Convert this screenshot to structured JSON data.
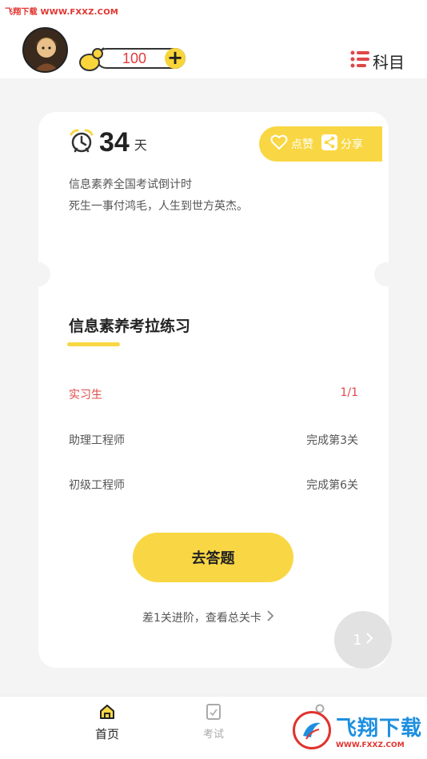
{
  "watermark": {
    "top_text": "飞翔下载 WWW.FXXZ.COM",
    "logo_name": "飞翔下载",
    "logo_url": "WWW.FXXZ.COM"
  },
  "header": {
    "avatar_icon": "avatar-image",
    "coins": "100",
    "coin_icon": "gourd-icon",
    "plus_icon": "plus-icon",
    "subject_label": "科目",
    "subject_icon": "list-icon"
  },
  "card": {
    "countdown_number": "34",
    "countdown_unit": "天",
    "countdown_icon": "alarm-clock-icon",
    "like_label": "点赞",
    "share_label": "分享",
    "subtitle": "信息素养全国考试倒计时",
    "motto": "死生一事付鸿毛，人生到世方英杰。",
    "section_title": "信息素养考拉练习",
    "levels": [
      {
        "name": "实习生",
        "status": "1/1",
        "active": true
      },
      {
        "name": "助理工程师",
        "status": "完成第3关",
        "active": false
      },
      {
        "name": "初级工程师",
        "status": "完成第6关",
        "active": false
      }
    ],
    "go_button": "去答题",
    "hint": "差1关进阶，查看总关卡"
  },
  "float_next": {
    "label": "1"
  },
  "tabs": [
    {
      "label": "首页",
      "icon": "home-icon",
      "active": true
    },
    {
      "label": "考试",
      "icon": "exam-icon",
      "active": false
    },
    {
      "label": "",
      "icon": "user-icon",
      "active": false
    }
  ],
  "colors": {
    "accent": "#f9d744",
    "active_level": "#e04848",
    "background": "#f4f4f4"
  }
}
